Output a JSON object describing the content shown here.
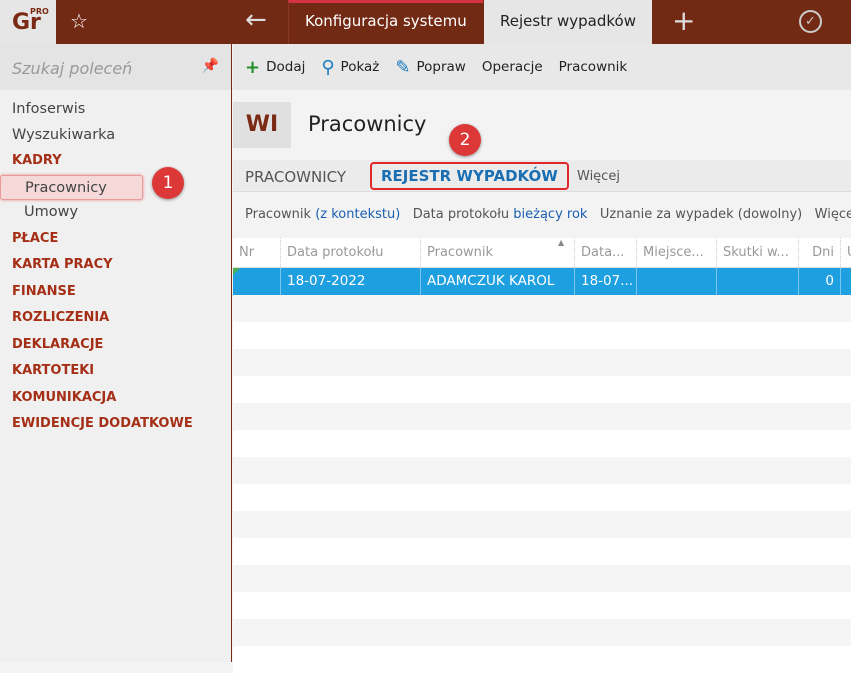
{
  "topbar": {
    "logo": "Gr",
    "logo_sup": "PRO",
    "tabs": [
      {
        "label": "Konfiguracja systemu"
      },
      {
        "label": "Rejestr wypadków"
      }
    ]
  },
  "sidebar": {
    "search_placeholder": "Szukaj poleceń",
    "items": [
      "Infoserwis",
      "Wyszukiwarka"
    ],
    "sections": [
      "KADRY",
      "PŁACE",
      "KARTA PRACY",
      "FINANSE",
      "ROZLICZENIA",
      "DEKLARACJE",
      "KARTOTEKI",
      "KOMUNIKACJA",
      "EWIDENCJE DODATKOWE"
    ],
    "kadry_sub": [
      "Pracownicy",
      "Umowy"
    ]
  },
  "toolbar": {
    "add": "Dodaj",
    "show": "Pokaż",
    "edit": "Popraw",
    "operations": "Operacje",
    "employee": "Pracownik"
  },
  "page": {
    "badge": "WI",
    "title": "Pracownicy"
  },
  "tabs": [
    "PRACOWNICY",
    "REJESTR WYPADKÓW",
    "Więcej"
  ],
  "filters": {
    "f1_label": "Pracownik",
    "f1_value": "(z kontekstu)",
    "f2_label": "Data protokołu",
    "f2_value": "bieżący rok",
    "f3": "Uznanie za wypadek (dowolny)",
    "more": "Więcej"
  },
  "grid": {
    "columns": [
      "Nr",
      "Data protokołu",
      "Pracownik",
      "Data...",
      "Miejsce...",
      "Skutki w...",
      "Dni",
      "U"
    ],
    "rows": [
      [
        "",
        "18-07-2022",
        "ADAMCZUK KAROL",
        "18-07...",
        "",
        "",
        "0",
        ""
      ]
    ]
  },
  "annotations": [
    "1",
    "2"
  ]
}
